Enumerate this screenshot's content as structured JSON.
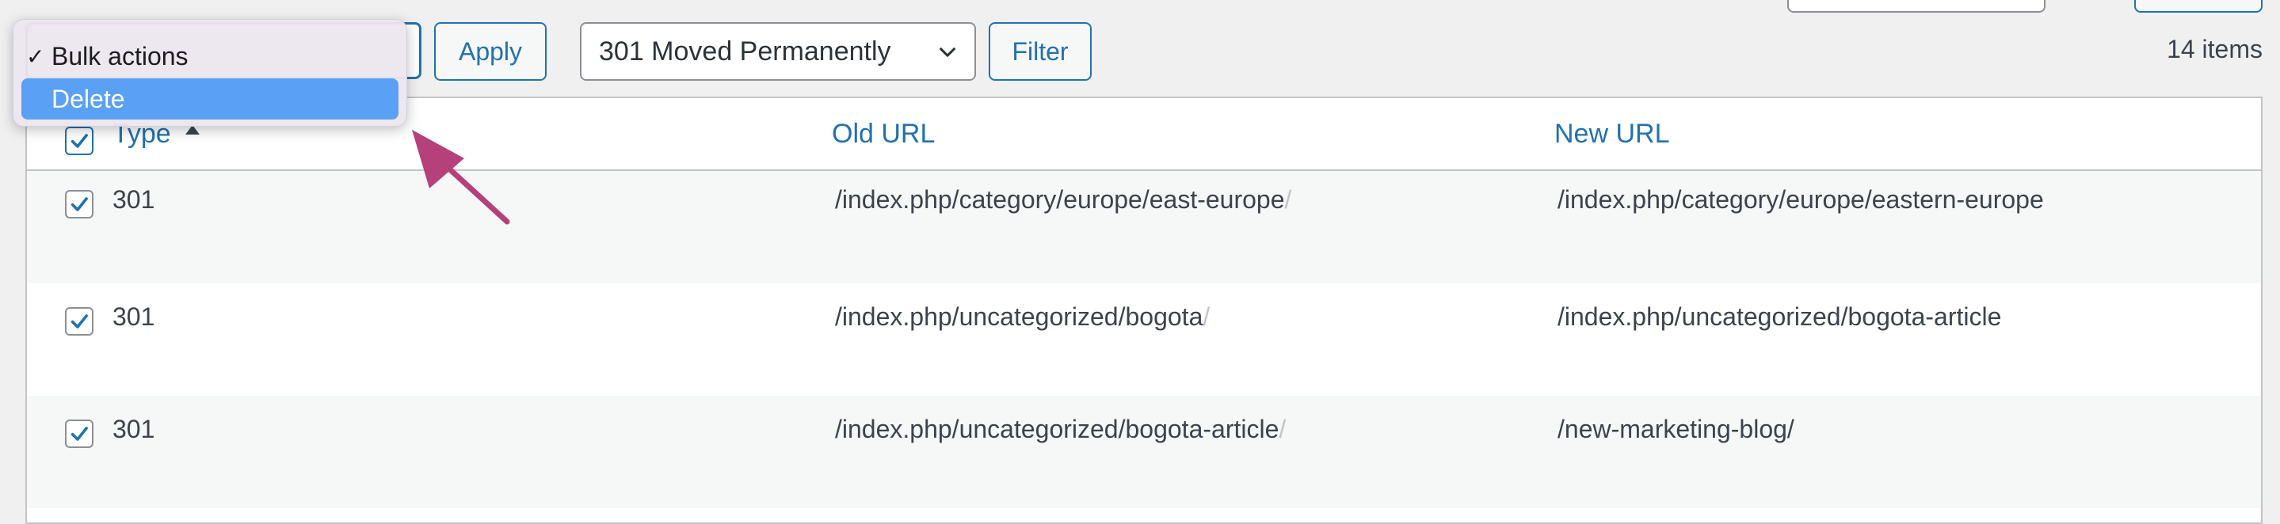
{
  "bulk_actions": {
    "options": [
      {
        "label": "Bulk actions",
        "checked": true
      },
      {
        "label": "Delete",
        "checked": false,
        "highlighted": true
      }
    ],
    "check_glyph": "✓"
  },
  "toolbar": {
    "apply_label": "Apply",
    "status_filter_value": "301 Moved Permanently",
    "filter_label": "Filter",
    "items_count": "14 items"
  },
  "table": {
    "headers": {
      "type": "Type",
      "old_url": "Old URL",
      "new_url": "New URL"
    },
    "sort_column": "Type",
    "sort_direction": "ascending",
    "rows": [
      {
        "type": "301",
        "old_url": "/index.php/category/europe/east-europe",
        "old_url_suffix": "/",
        "new_url": "/index.php/category/europe/eastern-europe",
        "checked": true
      },
      {
        "type": "301",
        "old_url": "/index.php/uncategorized/bogota",
        "old_url_suffix": "/",
        "new_url": "/index.php/uncategorized/bogota-article",
        "checked": true
      },
      {
        "type": "301",
        "old_url": "/index.php/uncategorized/bogota-article",
        "old_url_suffix": "/",
        "new_url": "/new-marketing-blog/",
        "checked": true
      }
    ]
  },
  "colors": {
    "accent": "#2271b1",
    "annotation_arrow": "#b5407a",
    "dropdown_highlight": "#5aa0f5"
  },
  "icons": {
    "checkbox_check": "checkmark-icon",
    "select_chevron": "chevron-down-icon",
    "sort": "sort-up-icon",
    "annotation": "arrow-pointer-icon"
  }
}
